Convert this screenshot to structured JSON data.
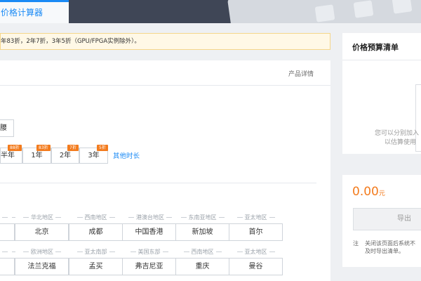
{
  "header": {
    "tab_label": "价格计算器"
  },
  "notice": {
    "text": "年83折，2年7折，3年5折（GPU/FPGA实例除外）。"
  },
  "main": {
    "detail_link": "产品详情",
    "partial_button": "腰",
    "durations": [
      {
        "label": "半年",
        "discount": "88折"
      },
      {
        "label": "1年",
        "discount": "83折"
      },
      {
        "label": "2年",
        "discount": "7折"
      },
      {
        "label": "3年",
        "discount": "5折"
      }
    ],
    "other_duration": "其他时长",
    "region_groups_row1": [
      "华北地区",
      "西南地区",
      "港澳台地区",
      "东南亚地区",
      "亚太地区"
    ],
    "cities_row1": [
      "北京",
      "成都",
      "中国香港",
      "新加坡",
      "首尔"
    ],
    "region_groups_row2": [
      "欧洲地区",
      "亚太南部",
      "美国东部",
      "西南地区",
      "亚太地区"
    ],
    "cities_row2": [
      "法兰克福",
      "孟买",
      "弗吉尼亚",
      "重庆",
      "曼谷"
    ]
  },
  "sidebar": {
    "title": "价格预算清单",
    "hint_line1": "您可以分别加入",
    "hint_line2": "以估算使用",
    "total_value": "0.00",
    "total_unit": "元",
    "export_label": "导出",
    "note_label": "注",
    "note_line1": "关闭该页面后系统不",
    "note_line2": "及时导出清单。"
  },
  "colors": {
    "accent": "#1a8af5",
    "discount": "#f37b1d",
    "notice_bg": "#fff8e6"
  }
}
